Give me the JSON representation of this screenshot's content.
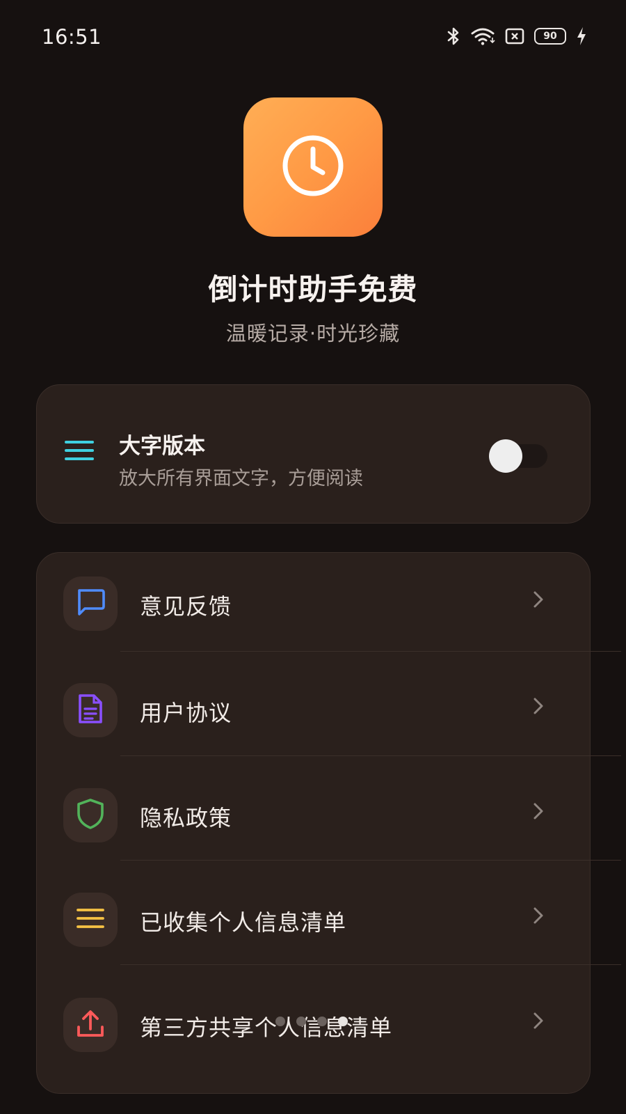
{
  "status_bar": {
    "time": "16:51",
    "battery_level": "90",
    "icons": [
      "bluetooth-icon",
      "wifi-icon",
      "sim-off-icon",
      "battery-icon",
      "charging-icon"
    ]
  },
  "app": {
    "title": "倒计时助手免费",
    "subtitle": "温暖记录·时光珍藏",
    "icon": "clock-icon",
    "icon_gradient": [
      "#ffae55",
      "#fb7f3b"
    ]
  },
  "large_text_setting": {
    "title": "大字版本",
    "description": "放大所有界面文字，方便阅读",
    "enabled": false,
    "icon": "menu-lines-icon",
    "icon_color": "#3fd0e0"
  },
  "menu": {
    "items": [
      {
        "label": "意见反馈",
        "icon": "chat-bubble-icon",
        "color": "#4f8cff"
      },
      {
        "label": "用户协议",
        "icon": "document-icon",
        "color": "#8a4fff"
      },
      {
        "label": "隐私政策",
        "icon": "shield-icon",
        "color": "#52b35a"
      },
      {
        "label": "已收集个人信息清单",
        "icon": "list-icon",
        "color": "#f6c244"
      },
      {
        "label": "第三方共享个人信息清单",
        "icon": "upload-icon",
        "color": "#ff5a5a"
      }
    ]
  },
  "page_indicator": {
    "count": 4,
    "active_index": 3
  },
  "colors": {
    "background": "#161110",
    "card": "#2a201c",
    "accent": "#fb8f41"
  }
}
